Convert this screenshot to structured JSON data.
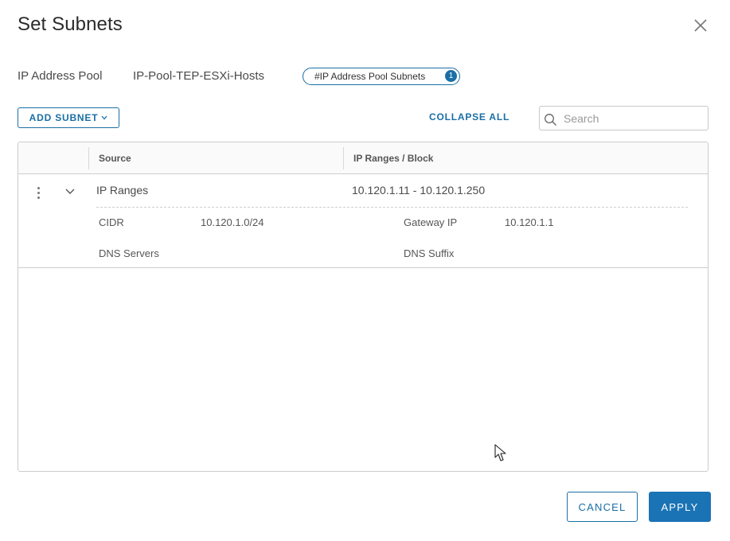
{
  "dialog": {
    "title": "Set Subnets",
    "close_icon": "close-icon"
  },
  "pool": {
    "label": "IP Address Pool",
    "value": "IP-Pool-TEP-ESXi-Hosts",
    "subnets_pill_label": "#IP Address Pool Subnets",
    "subnets_count": "1"
  },
  "toolbar": {
    "add_subnet_label": "ADD SUBNET",
    "add_subnet_icon": "chevron-down-icon",
    "collapse_all_label": "COLLAPSE ALL",
    "search_icon": "search-icon",
    "search_placeholder": "Search",
    "search_value": ""
  },
  "grid": {
    "columns": [
      "Source",
      "IP Ranges / Block"
    ],
    "rows": [
      {
        "actions_icon": "kebab-menu-icon",
        "expand_icon": "chevron-down-icon",
        "source": "IP Ranges",
        "ip_ranges": "10.120.1.11 - 10.120.1.250",
        "details": {
          "cidr_label": "CIDR",
          "cidr_value": "10.120.1.0/24",
          "gateway_label": "Gateway IP",
          "gateway_value": "10.120.1.1",
          "dns_servers_label": "DNS Servers",
          "dns_servers_value": "",
          "dns_suffix_label": "DNS Suffix",
          "dns_suffix_value": ""
        }
      }
    ]
  },
  "footer": {
    "cancel_label": "CANCEL",
    "apply_label": "APPLY"
  },
  "colors": {
    "accent": "#1a6fa6",
    "primary_button": "#1a73b5",
    "border": "#cccccc"
  }
}
